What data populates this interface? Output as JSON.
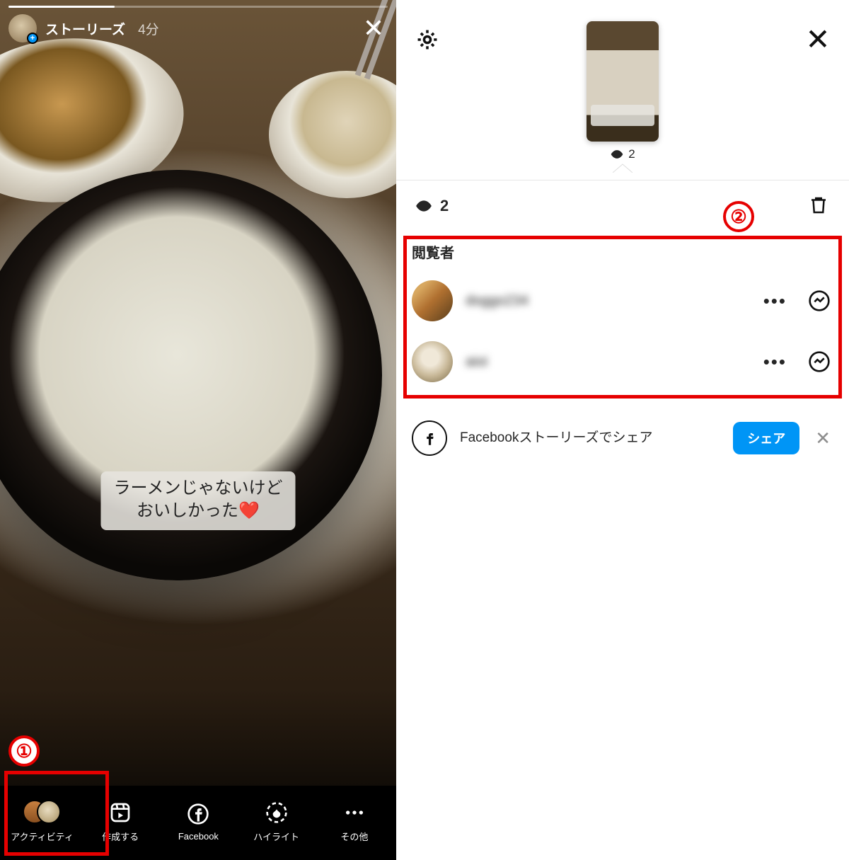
{
  "left": {
    "header": {
      "title": "ストーリーズ",
      "time": "4分"
    },
    "caption": {
      "line1": "ラーメンじゃないけど",
      "line2": "おいしかった",
      "heart": "❤️"
    },
    "bottom": {
      "activity": "アクティビティ",
      "create": "作成する",
      "facebook": "Facebook",
      "highlight": "ハイライト",
      "more": "その他"
    }
  },
  "right": {
    "thumb_views": "2",
    "view_count": "2",
    "viewers_heading": "閲覧者",
    "viewers": [
      {
        "name": "doggo234"
      },
      {
        "name": "aioi"
      }
    ],
    "facebook_share": {
      "text": "Facebookストーリーズでシェア",
      "button": "シェア"
    }
  },
  "annotations": {
    "one": "①",
    "two": "②"
  }
}
